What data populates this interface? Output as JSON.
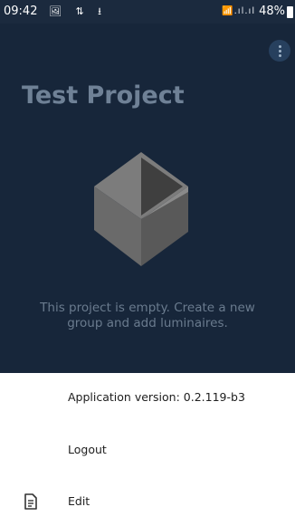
{
  "status_bar": {
    "time": "09:42",
    "icons": "🖼 ⇅ ⭳",
    "signal": "📶.ıl.ıl",
    "battery": "48%"
  },
  "project": {
    "title": "Test Project",
    "empty_message": "This project is empty. Create a new group and add luminaires."
  },
  "drawer": {
    "version_label": "Application version: 0.2.119-b3",
    "logout_label": "Logout",
    "edit_label": "Edit"
  },
  "colors": {
    "hero_background": "#17263a",
    "title_color": "#6f8196",
    "message_color": "#6a7b8e"
  },
  "icons": {
    "overflow": "more-vert-icon",
    "empty_state": "cube-icon",
    "edit": "document-icon"
  }
}
